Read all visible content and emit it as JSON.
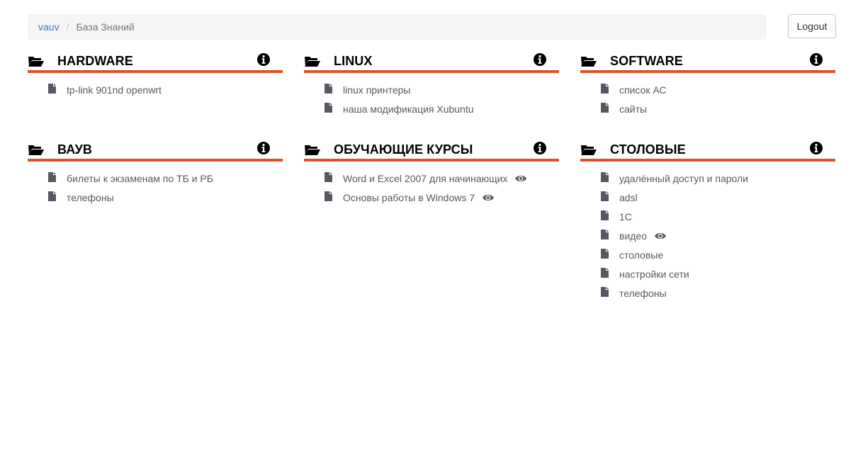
{
  "breadcrumb": {
    "home": "vauv",
    "separator": "/",
    "current": "База Знаний"
  },
  "logout_label": "Logout",
  "colors": {
    "accent": "#d9532c",
    "link": "#337ab7",
    "doc_text": "#555a62"
  },
  "icons": {
    "folder": "folder-open-icon",
    "info": "info-circle-icon",
    "file": "file-icon",
    "eye": "eye-icon"
  },
  "categories": [
    {
      "title": "HARDWARE",
      "docs": [
        {
          "label": "tp-link 901nd openwrt",
          "viewed": false
        }
      ]
    },
    {
      "title": "LINUX",
      "docs": [
        {
          "label": "linux принтеры",
          "viewed": false
        },
        {
          "label": "наша модификация Xubuntu",
          "viewed": false
        }
      ]
    },
    {
      "title": "SOFTWARE",
      "docs": [
        {
          "label": "список АС",
          "viewed": false
        },
        {
          "label": "сайты",
          "viewed": false
        }
      ]
    },
    {
      "title": "ВАУВ",
      "docs": [
        {
          "label": "билеты к экзаменам по ТБ и РБ",
          "viewed": false
        },
        {
          "label": "телефоны",
          "viewed": false
        }
      ]
    },
    {
      "title": "ОБУЧАЮЩИЕ КУРСЫ",
      "docs": [
        {
          "label": "Word и Excel 2007 для начинающих",
          "viewed": true
        },
        {
          "label": "Основы работы в Windows 7",
          "viewed": true
        }
      ]
    },
    {
      "title": "СТОЛОВЫЕ",
      "docs": [
        {
          "label": "удалённый доступ и пароли",
          "viewed": false
        },
        {
          "label": "adsl",
          "viewed": false
        },
        {
          "label": "1С",
          "viewed": false
        },
        {
          "label": "видео",
          "viewed": true
        },
        {
          "label": "столовые",
          "viewed": false
        },
        {
          "label": "настройки сети",
          "viewed": false
        },
        {
          "label": "телефоны",
          "viewed": false
        }
      ]
    }
  ]
}
